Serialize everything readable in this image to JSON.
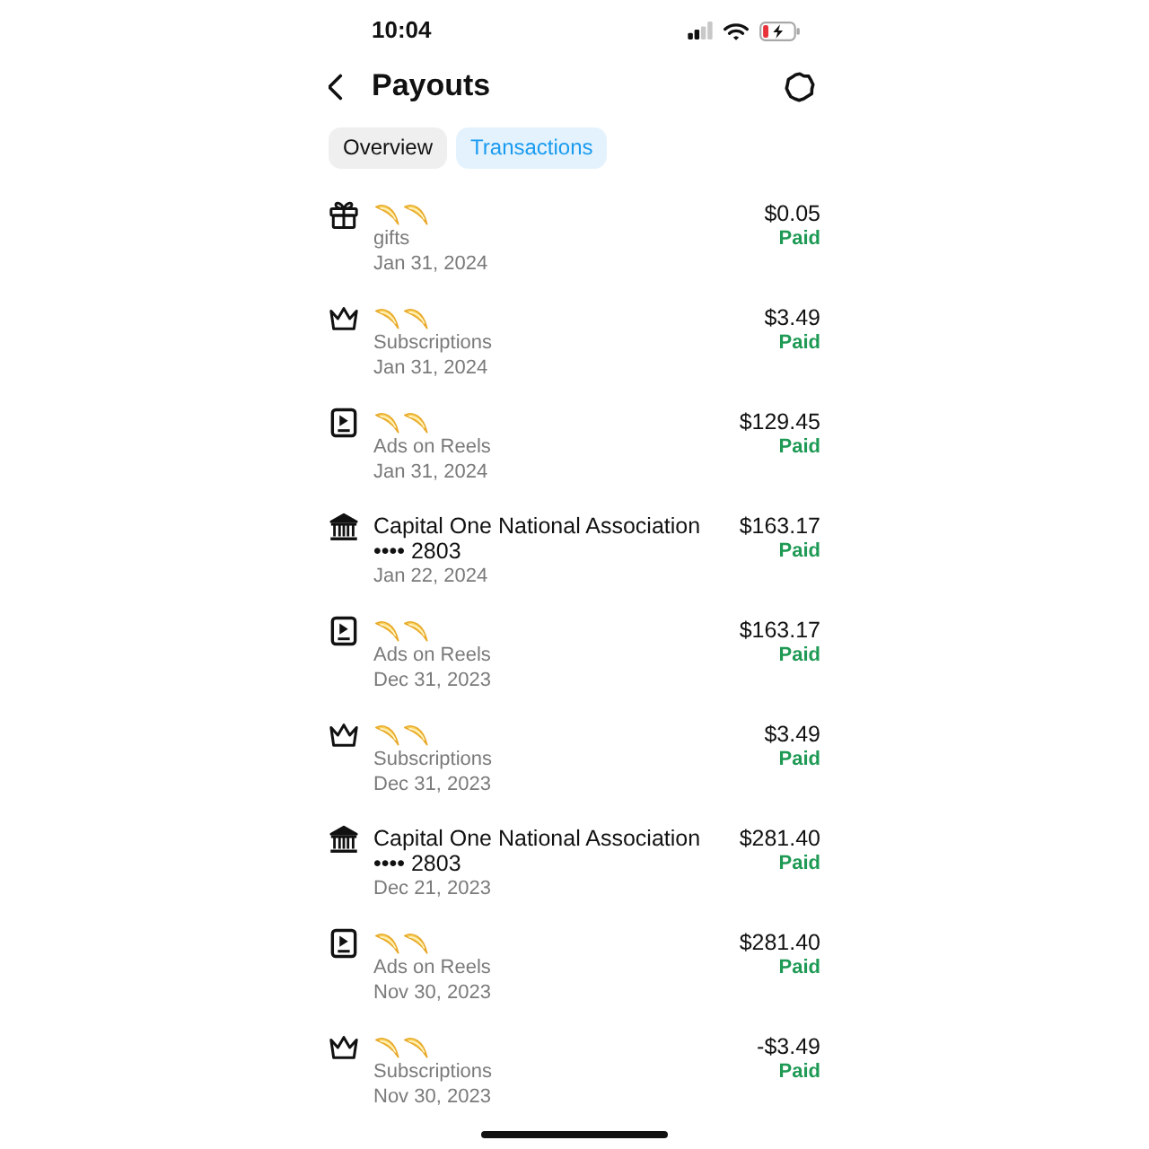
{
  "status_bar": {
    "time": "10:04"
  },
  "header": {
    "title": "Payouts"
  },
  "tabs": [
    {
      "label": "Overview",
      "selected": false
    },
    {
      "label": "Transactions",
      "selected": true
    }
  ],
  "transactions": [
    {
      "kind": "gift",
      "title_emojis": [
        {
          "kind": "dizzy"
        },
        {
          "kind": "dizzy"
        }
      ],
      "category": "gifts",
      "date": "Jan 31, 2024",
      "amount": "$0.05",
      "status": "Paid"
    },
    {
      "kind": "subscription",
      "title_emojis": [
        {
          "kind": "dizzy"
        },
        {
          "kind": "dizzy"
        }
      ],
      "category": "Subscriptions",
      "date": "Jan 31, 2024",
      "amount": "$3.49",
      "status": "Paid"
    },
    {
      "kind": "reels",
      "title_emojis": [
        {
          "kind": "dizzy"
        },
        {
          "kind": "dizzy"
        }
      ],
      "category": "Ads on Reels",
      "date": "Jan 31, 2024",
      "amount": "$129.45",
      "status": "Paid"
    },
    {
      "kind": "bank",
      "title": "Capital One National Association",
      "account": "•••• 2803",
      "date": "Jan 22, 2024",
      "amount": "$163.17",
      "status": "Paid"
    },
    {
      "kind": "reels",
      "title_emojis": [
        {
          "kind": "dizzy"
        },
        {
          "kind": "dizzy"
        }
      ],
      "category": "Ads on Reels",
      "date": "Dec 31, 2023",
      "amount": "$163.17",
      "status": "Paid"
    },
    {
      "kind": "subscription",
      "title_emojis": [
        {
          "kind": "dizzy"
        },
        {
          "kind": "dizzy"
        }
      ],
      "category": "Subscriptions",
      "date": "Dec 31, 2023",
      "amount": "$3.49",
      "status": "Paid"
    },
    {
      "kind": "bank",
      "title": "Capital One National Association",
      "account": "•••• 2803",
      "date": "Dec 21, 2023",
      "amount": "$281.40",
      "status": "Paid"
    },
    {
      "kind": "reels",
      "title_emojis": [
        {
          "kind": "dizzy"
        },
        {
          "kind": "dizzy"
        }
      ],
      "category": "Ads on Reels",
      "date": "Nov 30, 2023",
      "amount": "$281.40",
      "status": "Paid"
    },
    {
      "kind": "subscription",
      "title_emojis": [
        {
          "kind": "dizzy"
        },
        {
          "kind": "dizzy"
        }
      ],
      "category": "Subscriptions",
      "date": "Nov 30, 2023",
      "amount": "-$3.49",
      "status": "Paid"
    }
  ]
}
